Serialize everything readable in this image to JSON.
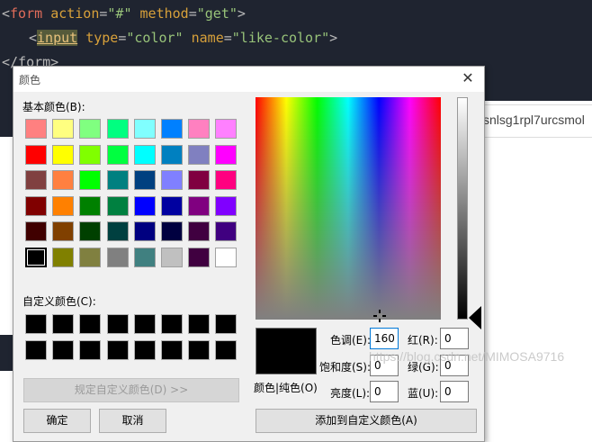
{
  "code": {
    "line1": {
      "open": "<",
      "tag": "form",
      "a1": "action",
      "eq1": "=",
      "v1": "\"#\"",
      "a2": "method",
      "eq2": "=",
      "v2": "\"get\"",
      "close": ">"
    },
    "line2": {
      "open": "<",
      "tag": "input",
      "a1": "type",
      "eq1": "=",
      "v1": "\"color\"",
      "a2": "name",
      "eq2": "=",
      "v2": "\"like-color\"",
      "close": ">"
    },
    "line3": {
      "text": "</form>"
    }
  },
  "background_url_fragment": "snlsg1rpl7urcsmol",
  "dialog": {
    "title": "颜色",
    "close_glyph": "✕",
    "basic_colors_label": "基本颜色(B):",
    "basic_colors": [
      [
        "#ff8080",
        "#ffff80",
        "#80ff80",
        "#00ff80",
        "#80ffff",
        "#0080ff",
        "#ff80c0",
        "#ff80ff"
      ],
      [
        "#ff0000",
        "#ffff00",
        "#80ff00",
        "#00ff40",
        "#00ffff",
        "#0080c0",
        "#8080c0",
        "#ff00ff"
      ],
      [
        "#804040",
        "#ff8040",
        "#00ff00",
        "#008080",
        "#004080",
        "#8080ff",
        "#800040",
        "#ff0080"
      ],
      [
        "#800000",
        "#ff8000",
        "#008000",
        "#008040",
        "#0000ff",
        "#0000a0",
        "#800080",
        "#8000ff"
      ],
      [
        "#400000",
        "#804000",
        "#004000",
        "#004040",
        "#000080",
        "#000040",
        "#400040",
        "#400080"
      ],
      [
        "#000000",
        "#808000",
        "#808040",
        "#808080",
        "#408080",
        "#c0c0c0",
        "#400040",
        "#ffffff"
      ]
    ],
    "custom_colors_label": "自定义颜色(C):",
    "define_custom_button": "规定自定义颜色(D) >>",
    "ok_button": "确定",
    "cancel_button": "取消",
    "preview_label": "颜色|纯色(O)",
    "hue_label": "色调(E):",
    "hue_value": "160",
    "sat_label": "饱和度(S):",
    "sat_value": "0",
    "lum_label": "亮度(L):",
    "lum_value": "0",
    "red_label": "红(R):",
    "red_value": "0",
    "green_label": "绿(G):",
    "green_value": "0",
    "blue_label": "蓝(U):",
    "blue_value": "0",
    "add_custom_button": "添加到自定义颜色(A)",
    "selected_color": "#000000"
  },
  "watermark": "https://blog.csdn.net/MIMOSA9716"
}
